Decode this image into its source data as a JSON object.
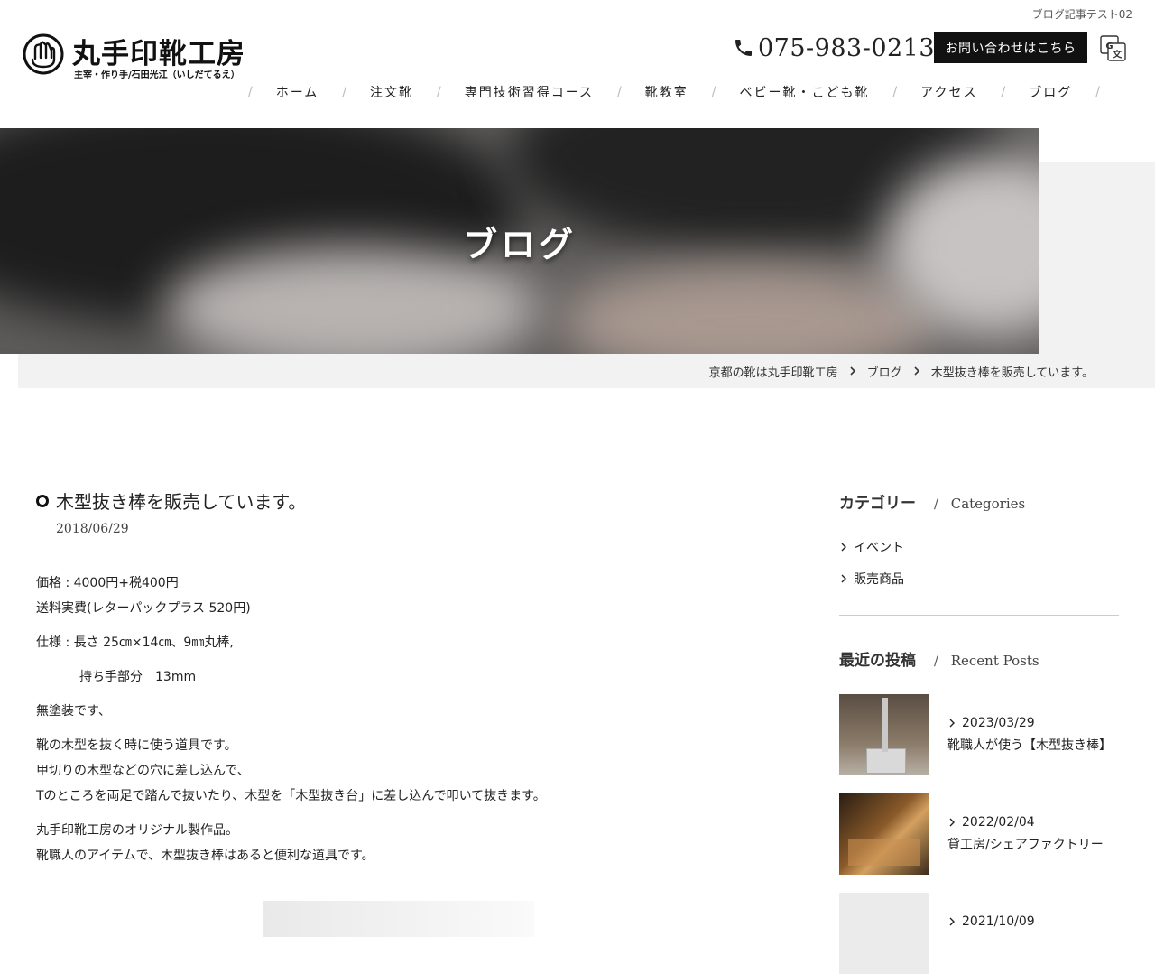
{
  "header": {
    "topnote": "ブログ記事テスト02",
    "logo_text": "丸手印靴工房",
    "logo_subtitle": "主宰・作り手/石田光江（いしだてるえ）",
    "phone": "075-983-0213",
    "contact_label": "お問い合わせはこちら"
  },
  "nav": {
    "items": [
      {
        "label": "ホーム"
      },
      {
        "label": "注文靴"
      },
      {
        "label": "専門技術習得コース"
      },
      {
        "label": "靴教室"
      },
      {
        "label": "ベビー靴・こども靴"
      },
      {
        "label": "アクセス"
      },
      {
        "label": "ブログ"
      }
    ]
  },
  "hero": {
    "title": "ブログ"
  },
  "breadcrumb": [
    "京都の靴は丸手印靴工房",
    "ブログ",
    "木型抜き棒を販売しています。"
  ],
  "post": {
    "title": "木型抜き棒を販売しています。",
    "date": "2018/06/29",
    "paragraphs": [
      "価格 : 4000円+税400円",
      "送料実費(レターパックプラス 520円)",
      "仕様 : 長さ 25㎝×14㎝、9㎜丸棒,",
      "持ち手部分　13mm",
      "無塗装です、",
      "靴の木型を抜く時に使う道具です。",
      "甲切りの木型などの穴に差し込んで、",
      "Tのところを両足で踏んで抜いたり、木型を「木型抜き台」に差し込んで叩いて抜きます。",
      "丸手印靴工房のオリジナル製作品。",
      "靴職人のアイテムで、木型抜き棒はあると便利な道具です。"
    ]
  },
  "sidebar": {
    "categories": {
      "heading": "カテゴリー",
      "heading_en": "Categories",
      "items": [
        {
          "label": "イベント"
        },
        {
          "label": "販売商品"
        }
      ]
    },
    "recent": {
      "heading": "最近の投稿",
      "heading_en": "Recent Posts",
      "posts": [
        {
          "date": "2023/03/29",
          "title": "靴職人が使う【木型抜き棒】"
        },
        {
          "date": "2022/02/04",
          "title": "貸工房/シェアファクトリー"
        },
        {
          "date": "2021/10/09",
          "title": ""
        }
      ]
    }
  },
  "colors": {
    "accent": "#111111",
    "band": "#f2f2f2"
  }
}
